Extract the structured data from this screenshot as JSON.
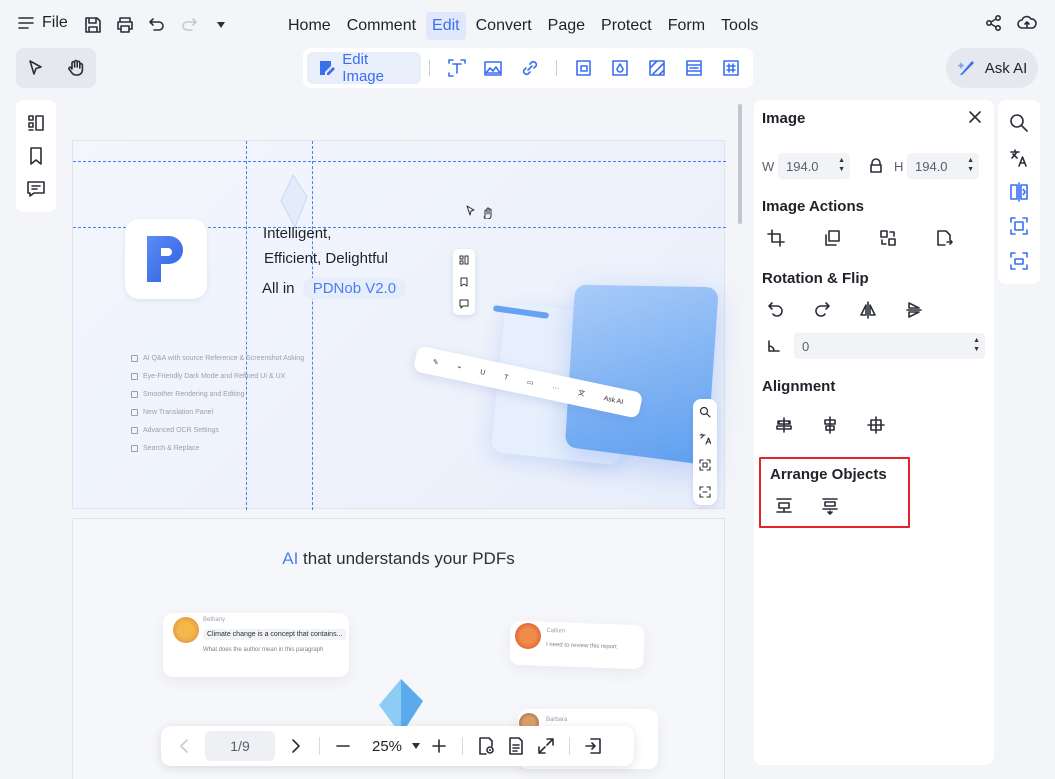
{
  "topbar": {
    "file_label": "File",
    "menu_tabs": [
      "Home",
      "Comment",
      "Edit",
      "Convert",
      "Page",
      "Protect",
      "Form",
      "Tools"
    ],
    "active_tab": "Edit"
  },
  "edit_toolbar": {
    "edit_image_label": "Edit Image",
    "tools": [
      "add-text-icon",
      "add-image-icon",
      "add-link-icon",
      "crop-page-icon",
      "watermark-icon",
      "background-icon",
      "header-footer-icon",
      "bates-number-icon"
    ]
  },
  "ask_ai": {
    "label": "Ask AI"
  },
  "document": {
    "page1": {
      "hero_line1": "Intelligent,",
      "hero_line2": "Efficient,  Delightful",
      "hero_line3_prefix": "All in",
      "hero_line3_version": "PDNob V2.0",
      "features": [
        "AI Q&A with source Reference & Screenshot Asking",
        "Eye-Friendly Dark Mode and Refined UI & UX",
        "Smoother Rendering and Editing",
        "New Translation Panel",
        "Advanced OCR Settings",
        "Search & Replace"
      ],
      "mock_toolbar_label": "Ask AI"
    },
    "page2": {
      "title_ai": "AI",
      "title_rest": " that understands your PDFs",
      "chat1_name": "Bethany",
      "chat1_quote": "Climate change is a concept that contains...",
      "chat1_question": "What does the author mean in this paragraph",
      "chat2_name": "Callum",
      "chat2_msg": "I need to review this report",
      "chat3_name": "Barbara"
    }
  },
  "bottom_nav": {
    "page_indicator": "1/9",
    "zoom": "25%"
  },
  "right_panel": {
    "title": "Image",
    "width_label": "W",
    "width_value": "194.0",
    "height_label": "H",
    "height_value": "194.0",
    "image_actions_title": "Image Actions",
    "rotation_title": "Rotation & Flip",
    "rotation_value": "0",
    "alignment_title": "Alignment",
    "arrange_title": "Arrange Objects"
  },
  "colors": {
    "accent": "#3a6ff0",
    "highlight": "#e0262c",
    "guide": "#4a7ff0"
  }
}
